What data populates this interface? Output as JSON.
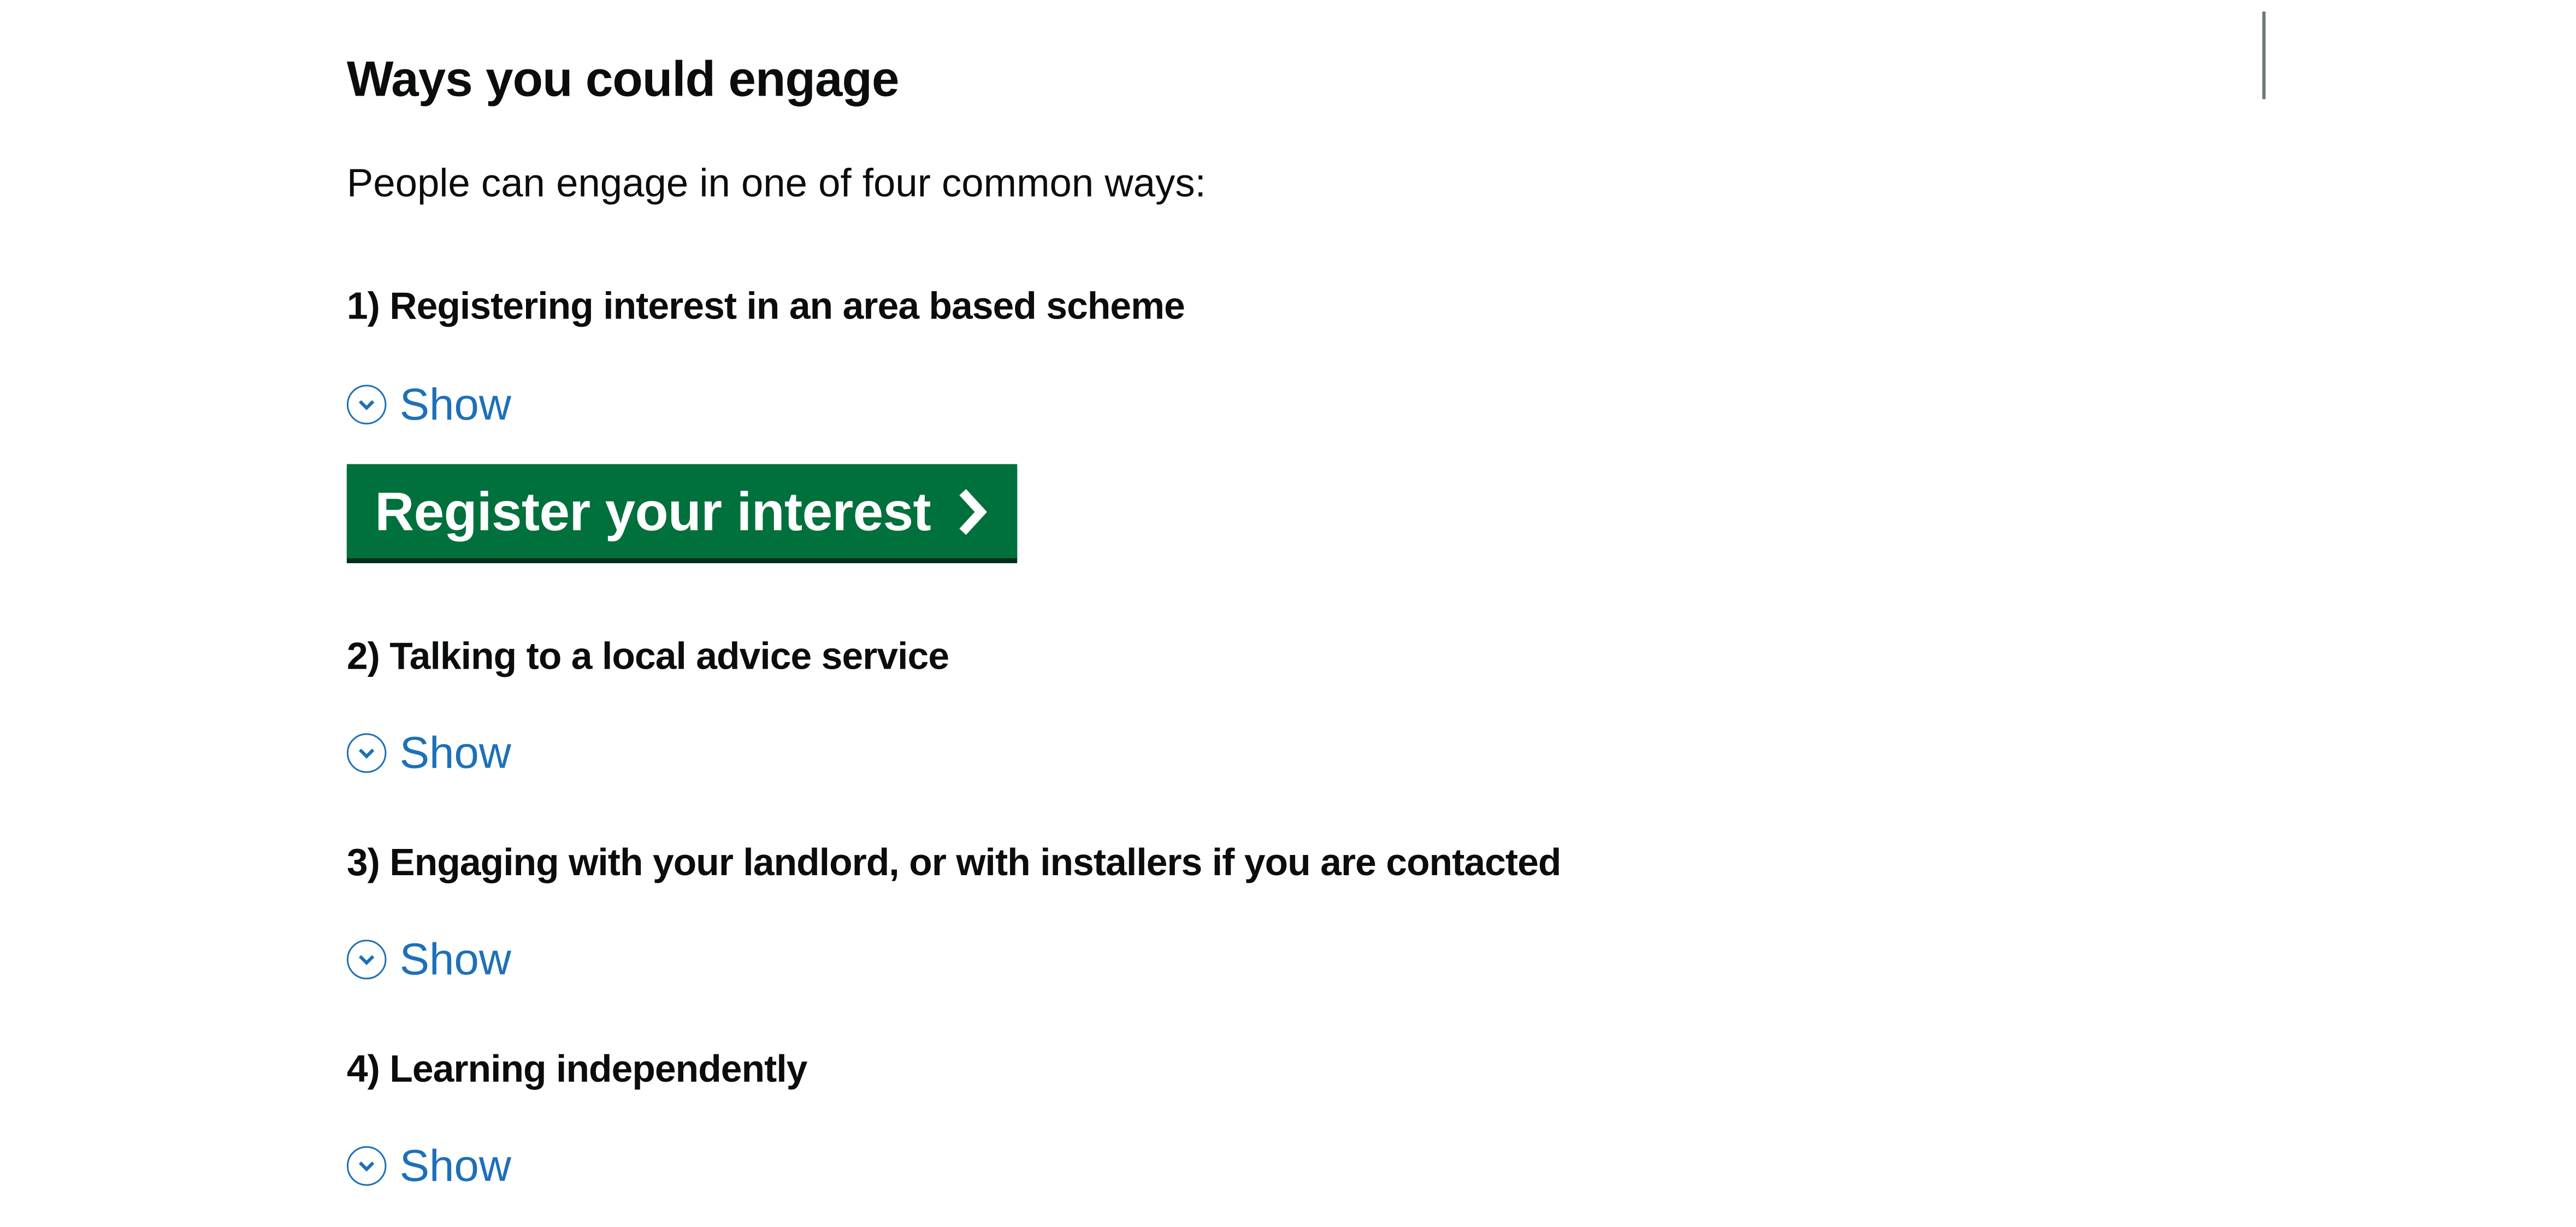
{
  "section": {
    "heading": "Ways you could engage",
    "intro": "People can engage in one of four common ways:"
  },
  "ways": [
    {
      "heading": "1) Registering interest in an area based scheme",
      "toggle_label": "Show"
    },
    {
      "heading": "2) Talking to a local advice service",
      "toggle_label": "Show"
    },
    {
      "heading": "3) Engaging with your landlord, or with installers if you are contacted",
      "toggle_label": "Show"
    },
    {
      "heading": "4) Learning independently",
      "toggle_label": "Show"
    }
  ],
  "cta": {
    "label": "Register your interest",
    "icon": "chevron-right-icon"
  },
  "icons": {
    "toggle": "chevron-down-icon"
  },
  "colors": {
    "link": "#1d70b8",
    "button": "#00703c",
    "button_shadow": "#002d18",
    "text": "#0b0c0c"
  }
}
